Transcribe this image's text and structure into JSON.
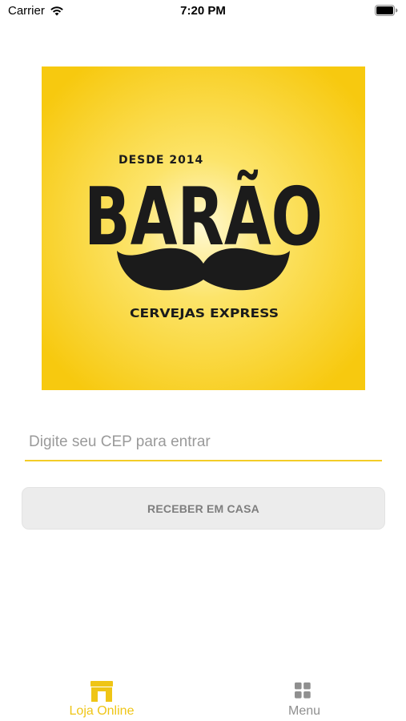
{
  "status_bar": {
    "carrier": "Carrier",
    "time": "7:20 PM",
    "icons": [
      "wifi-icon",
      "battery-icon"
    ]
  },
  "logo": {
    "since_text": "DESDE 2014",
    "brand_text": "BARÃO",
    "tagline": "CERVEJAS EXPRESS",
    "colors": {
      "background": "#f8cc14",
      "center": "#fff7cc",
      "ink": "#1b1b1b"
    }
  },
  "cep": {
    "placeholder": "Digite seu CEP para entrar",
    "value": ""
  },
  "receive_button": {
    "label": "RECEBER EM CASA"
  },
  "tab_bar": {
    "tabs": [
      {
        "label": "Loja Online",
        "icon": "storefront-icon",
        "active": true
      },
      {
        "label": "Menu",
        "icon": "grid-icon",
        "active": false
      }
    ]
  },
  "colors": {
    "accent": "#f3cc27",
    "active_tab": "#efc516",
    "inactive_tab": "#8f8f8f"
  }
}
